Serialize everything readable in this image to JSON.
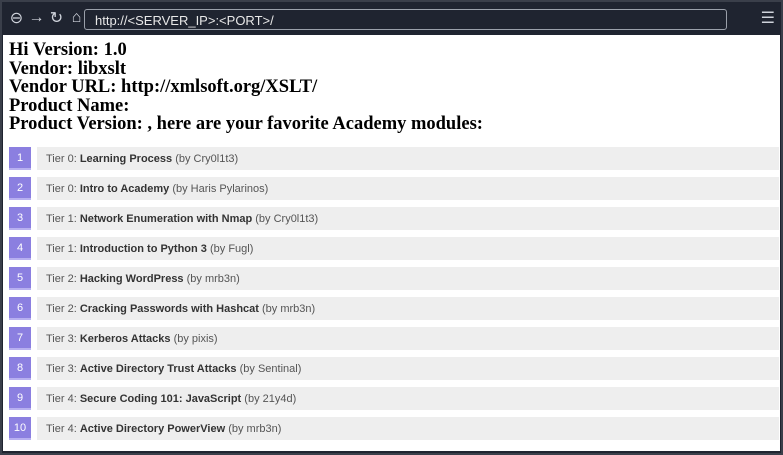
{
  "browser": {
    "url": "http://<SERVER_IP>:<PORT>/"
  },
  "info": [
    "Hi Version: 1.0",
    "Vendor: libxslt",
    "Vendor URL: http://xmlsoft.org/XSLT/",
    "Product Name:",
    "Product Version: , here are your favorite Academy modules:"
  ],
  "modules": [
    {
      "n": "1",
      "tier": "Tier 0: ",
      "name": "Learning Process",
      "author": " (by Cry0l1t3)"
    },
    {
      "n": "2",
      "tier": "Tier 0: ",
      "name": "Intro to Academy",
      "author": " (by Haris Pylarinos)"
    },
    {
      "n": "3",
      "tier": "Tier 1: ",
      "name": "Network Enumeration with Nmap",
      "author": " (by Cry0l1t3)"
    },
    {
      "n": "4",
      "tier": "Tier 1: ",
      "name": "Introduction to Python 3",
      "author": " (by Fugl)"
    },
    {
      "n": "5",
      "tier": "Tier 2: ",
      "name": "Hacking WordPress",
      "author": " (by mrb3n)"
    },
    {
      "n": "6",
      "tier": "Tier 2: ",
      "name": "Cracking Passwords with Hashcat",
      "author": " (by mrb3n)"
    },
    {
      "n": "7",
      "tier": "Tier 3: ",
      "name": "Kerberos Attacks",
      "author": " (by pixis)"
    },
    {
      "n": "8",
      "tier": "Tier 3: ",
      "name": "Active Directory Trust Attacks",
      "author": " (by Sentinal)"
    },
    {
      "n": "9",
      "tier": "Tier 4: ",
      "name": "Secure Coding 101: JavaScript",
      "author": " (by 21y4d)"
    },
    {
      "n": "10",
      "tier": "Tier 4: ",
      "name": "Active Directory PowerView",
      "author": " (by mrb3n)"
    }
  ]
}
